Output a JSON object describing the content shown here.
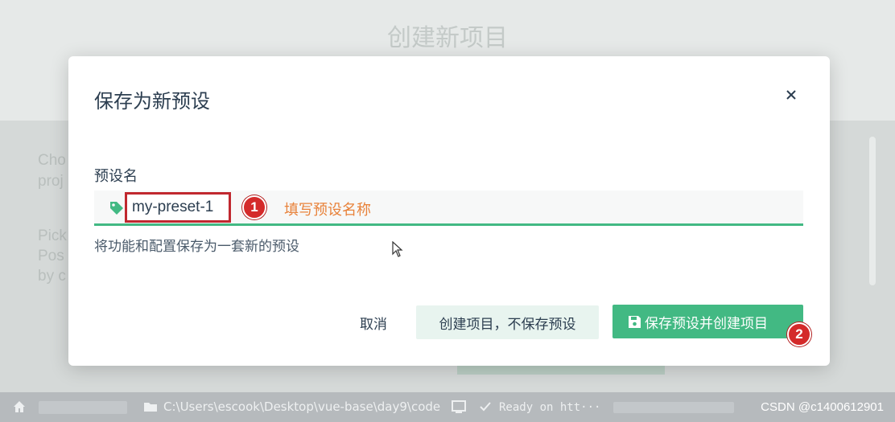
{
  "background": {
    "page_title": "创建新项目",
    "text_lines": [
      "Cho",
      "proj",
      "Pick",
      "Pos",
      "by c"
    ]
  },
  "modal": {
    "title": "保存为新预设",
    "close_label": "×",
    "field": {
      "label": "预设名",
      "value": "my-preset-1",
      "description": "将功能和配置保存为一套新的预设"
    },
    "annotations": {
      "step1_number": "1",
      "step1_text": "填写预设名称",
      "step2_number": "2"
    },
    "buttons": {
      "cancel": "取消",
      "create_without_save": "创建项目，不保存预设",
      "save_and_create": "保存预设并创建项目"
    }
  },
  "statusbar": {
    "path": "C:\\Users\\escook\\Desktop\\vue-base\\day9\\code",
    "log": "Ready on htt···"
  },
  "watermark": "CSDN @c1400612901",
  "colors": {
    "accent": "#42b983",
    "annotation_red": "#d42a2a",
    "annotation_orange": "#e8823a"
  }
}
